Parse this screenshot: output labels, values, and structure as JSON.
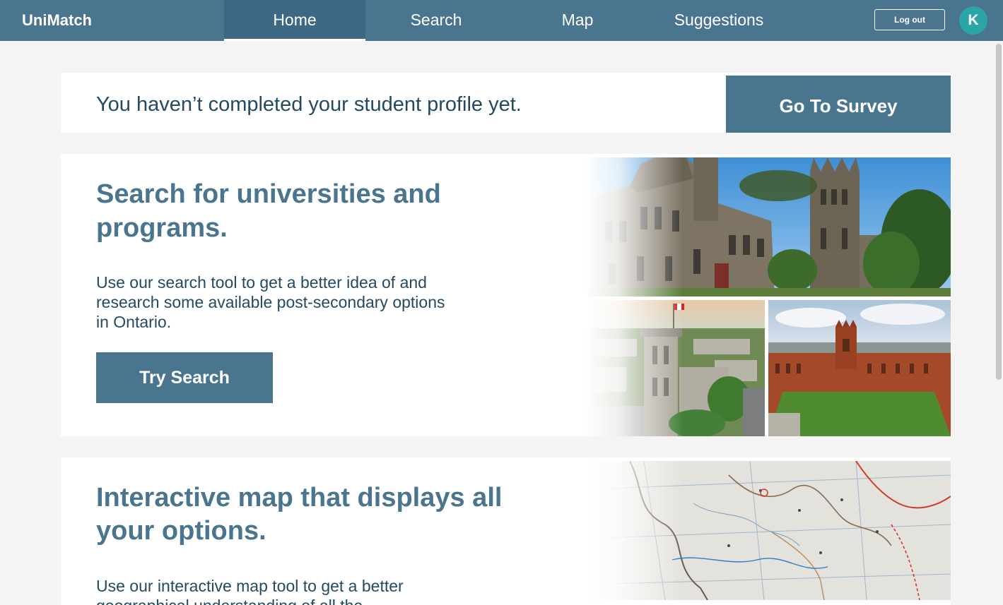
{
  "nav": {
    "brand": "UniMatch",
    "tabs": [
      {
        "label": "Home",
        "active": true
      },
      {
        "label": "Search",
        "active": false
      },
      {
        "label": "Map",
        "active": false
      },
      {
        "label": "Suggestions",
        "active": false
      }
    ],
    "logout_label": "Log out",
    "avatar_initial": "K"
  },
  "profile_banner": {
    "message": "You haven’t completed your student profile yet.",
    "button_label": "Go To Survey"
  },
  "search_card": {
    "title_line1": "Search for universities and",
    "title_line2": "programs.",
    "desc_line1": "Use our search tool to get a better idea of and",
    "desc_line2": "research some available post-secondary options",
    "desc_line3": "in Ontario.",
    "button_label": "Try Search"
  },
  "map_card": {
    "title_line1": "Interactive map that displays all",
    "title_line2": "your options.",
    "desc_line1": "Use our interactive map tool to get a better",
    "desc_line2": "geographical understanding of all the"
  },
  "colors": {
    "nav": "#4a758f",
    "nav_active": "#3d6883",
    "accent_button": "#4a758f",
    "title": "#4a758f",
    "body_text": "#244a62",
    "avatar": "#2aa6a9",
    "page_bg": "#f4f4f4"
  }
}
